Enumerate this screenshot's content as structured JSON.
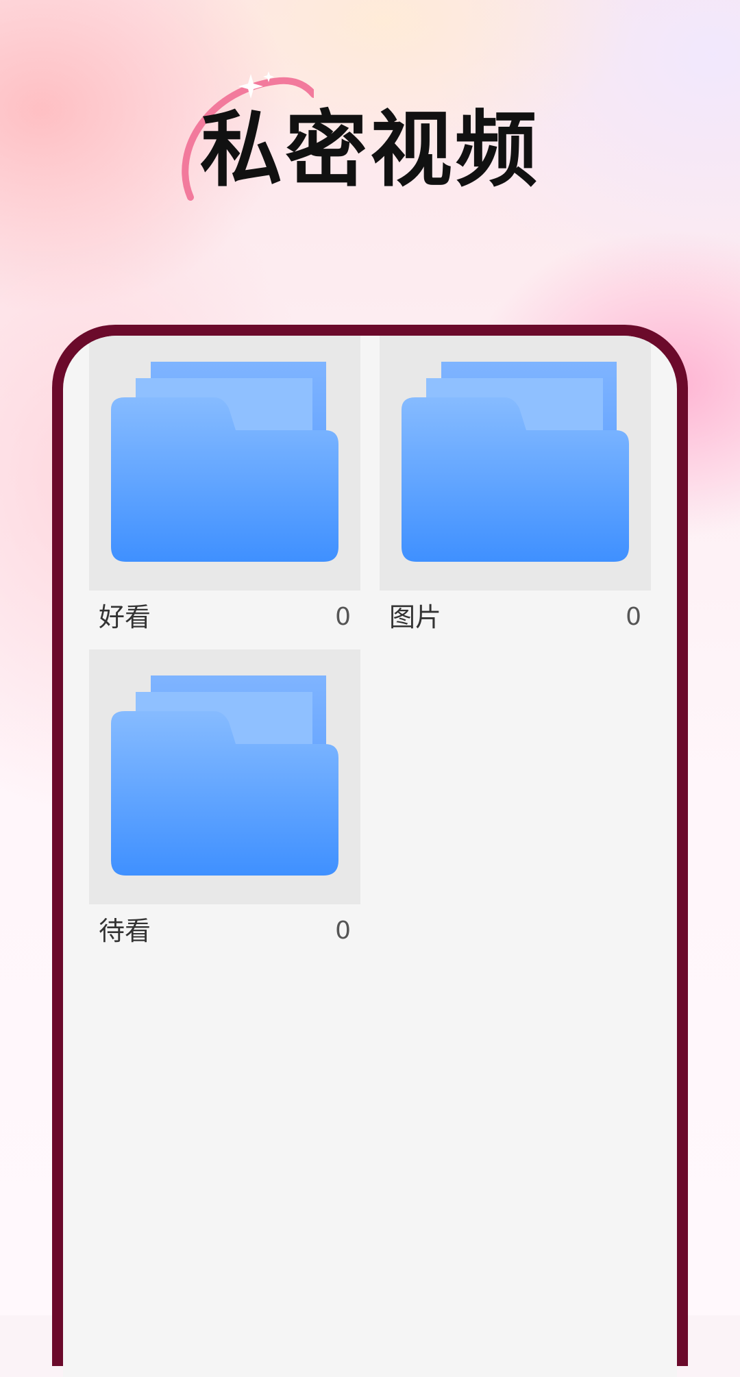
{
  "header": {
    "title": "私密视频",
    "decoration": "sparkle-arc-icon"
  },
  "colors": {
    "frame": "#6b0a2b",
    "screen": "#f5f5f5",
    "folder_top": "#86bbff",
    "folder_bottom": "#3f90ff",
    "arc": "#f27a9c"
  },
  "folders": [
    {
      "name": "好看",
      "count": "0",
      "icon": "folder-icon"
    },
    {
      "name": "图片",
      "count": "0",
      "icon": "folder-icon"
    },
    {
      "name": "待看",
      "count": "0",
      "icon": "folder-icon"
    }
  ]
}
